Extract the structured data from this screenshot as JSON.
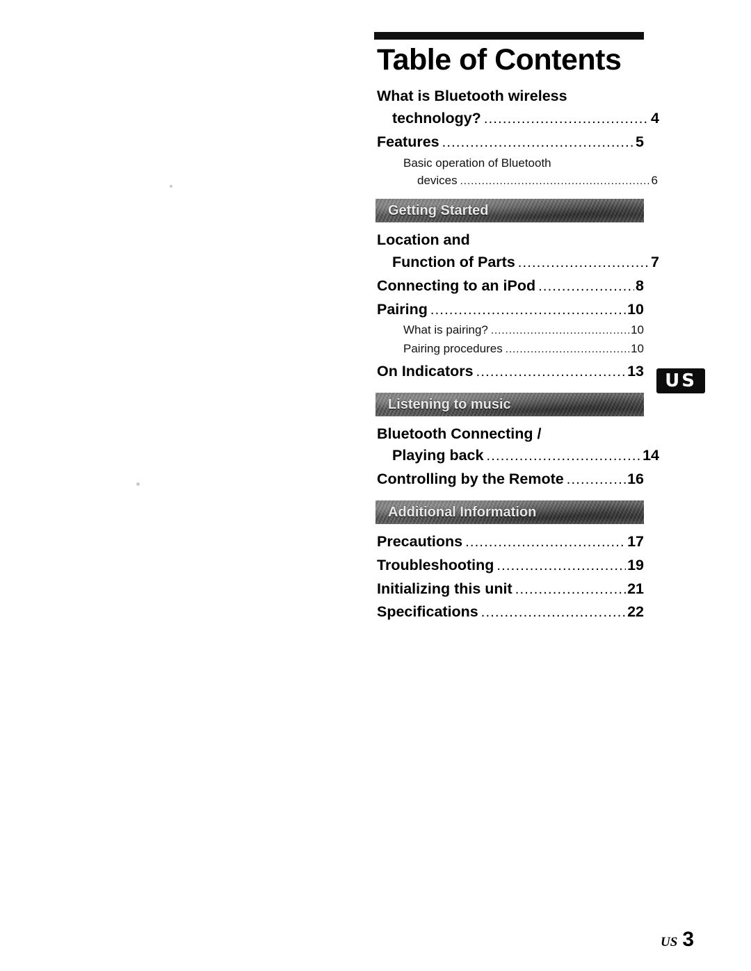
{
  "document": {
    "title": "Table of Contents",
    "dots": "..........................................................................................................",
    "thumb_tab": "US",
    "footer": {
      "locale": "US",
      "page_number": "3"
    }
  },
  "toc": {
    "entries": [
      {
        "level": 1,
        "lines": [
          "What is Bluetooth wireless",
          "technology?"
        ],
        "page": "4"
      },
      {
        "level": 1,
        "lines": [
          "Features"
        ],
        "page": "5"
      },
      {
        "level": 2,
        "lines": [
          "Basic operation of Bluetooth",
          "devices"
        ],
        "page": "6"
      }
    ],
    "sections": [
      {
        "heading": "Getting Started",
        "entries": [
          {
            "level": 1,
            "lines": [
              "Location and",
              "Function of Parts"
            ],
            "page": "7"
          },
          {
            "level": 1,
            "lines": [
              "Connecting to an iPod"
            ],
            "page": "8"
          },
          {
            "level": 1,
            "lines": [
              "Pairing"
            ],
            "page": "10"
          },
          {
            "level": 2,
            "lines": [
              "What is pairing?"
            ],
            "page": "10"
          },
          {
            "level": 2,
            "lines": [
              "Pairing procedures"
            ],
            "page": "10"
          },
          {
            "level": 1,
            "lines": [
              "On Indicators"
            ],
            "page": "13"
          }
        ]
      },
      {
        "heading": "Listening to music",
        "entries": [
          {
            "level": 1,
            "lines": [
              "Bluetooth Connecting /",
              "Playing back"
            ],
            "page": "14"
          },
          {
            "level": 1,
            "lines": [
              "Controlling by the Remote"
            ],
            "page": "16"
          }
        ]
      },
      {
        "heading": "Additional Information",
        "entries": [
          {
            "level": 1,
            "lines": [
              "Precautions"
            ],
            "page": "17"
          },
          {
            "level": 1,
            "lines": [
              "Troubleshooting"
            ],
            "page": "19"
          },
          {
            "level": 1,
            "lines": [
              "Initializing this unit"
            ],
            "page": "21"
          },
          {
            "level": 1,
            "lines": [
              "Specifications"
            ],
            "page": "22"
          }
        ]
      }
    ]
  }
}
